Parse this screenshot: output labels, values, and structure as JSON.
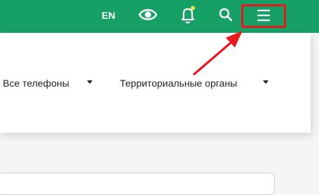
{
  "header": {
    "background": "#17a065",
    "lang_label": "EN",
    "icons": [
      "eye-icon",
      "bell-icon",
      "search-icon",
      "menu-icon"
    ],
    "notification_dot_color": "#f4e04d"
  },
  "annotation": {
    "color": "#e8191e"
  },
  "nav": {
    "items": [
      {
        "label": "Все телефоны"
      },
      {
        "label": "Территориальные органы"
      }
    ]
  }
}
